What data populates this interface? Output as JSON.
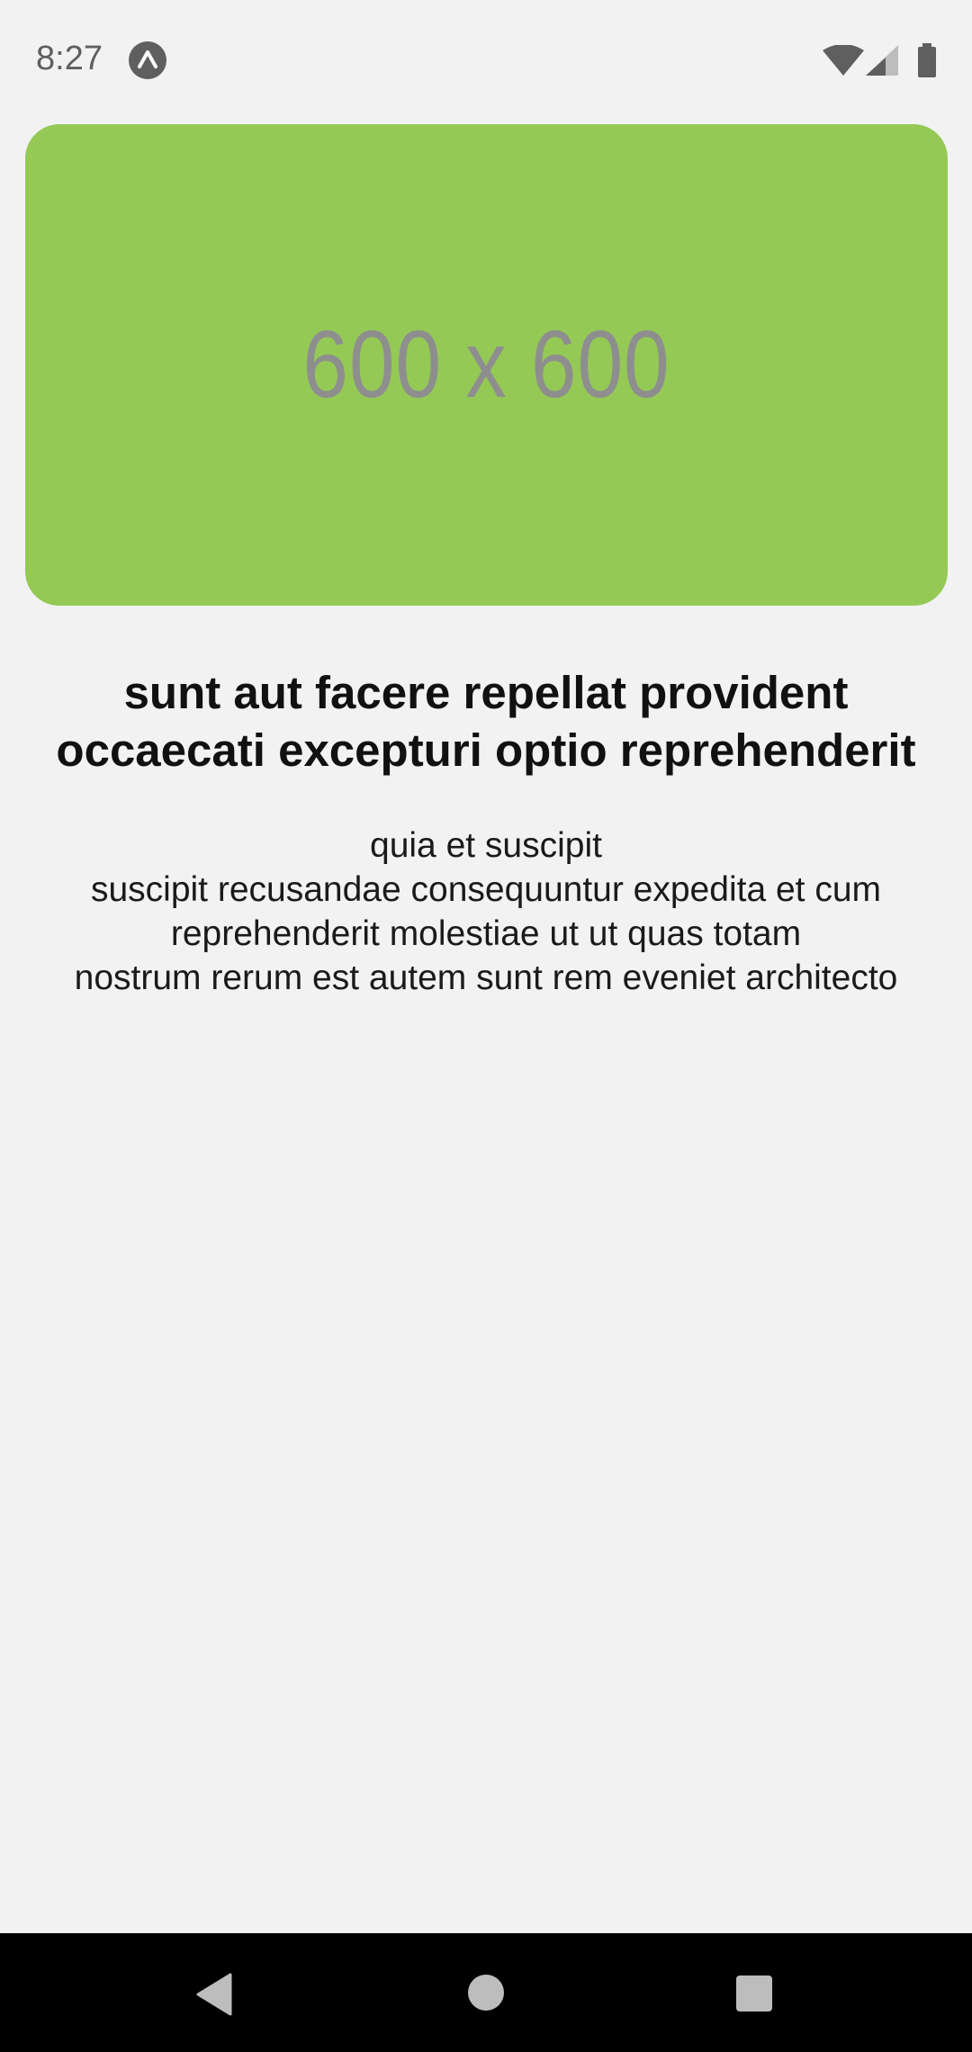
{
  "status_bar": {
    "time": "8:27",
    "app_icon": "expo-icon",
    "wifi_icon": "wifi-icon",
    "signal_icon": "cell-signal-icon",
    "battery_icon": "battery-icon"
  },
  "hero": {
    "placeholder_text": "600 x 600",
    "background_color": "#94c956",
    "text_color": "#8e8e8e"
  },
  "post": {
    "title": "sunt aut facere repellat provident occaecati excepturi optio reprehenderit",
    "body": "quia et suscipit\nsuscipit recusandae consequuntur expedita et cum\nreprehenderit molestiae ut ut quas totam\nnostrum rerum est autem sunt rem eveniet architecto"
  },
  "nav_bar": {
    "back_icon": "back-triangle-icon",
    "home_icon": "home-circle-icon",
    "recents_icon": "recents-square-icon"
  }
}
